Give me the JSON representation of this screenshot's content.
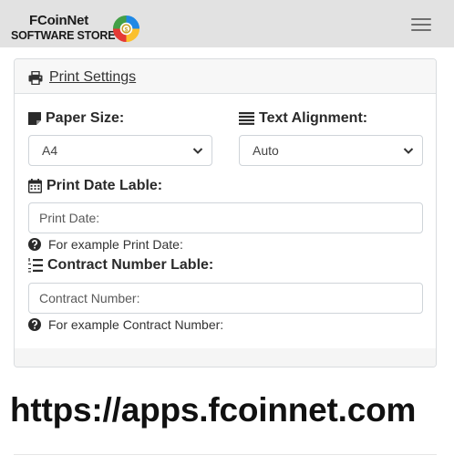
{
  "brand": {
    "name": "FCoinNet",
    "tagline": "SOFTWARE STORE",
    "logo_icon": "fcoinnet-logo-icon"
  },
  "navbar": {
    "toggle_icon": "hamburger-menu-icon"
  },
  "print_settings": {
    "title": "Print Settings",
    "title_icon": "printer-icon",
    "paper_size": {
      "label": "Paper Size:",
      "icon": "sticky-note-icon",
      "selected": "A4"
    },
    "text_alignment": {
      "label": "Text Alignment:",
      "icon": "align-justify-icon",
      "selected": "Auto"
    },
    "print_date_label": {
      "label": "Print Date Lable:",
      "icon": "calendar-icon",
      "value": "Print Date:",
      "hint": "For example Print Date:",
      "hint_icon": "question-circle-icon"
    },
    "contract_number_label": {
      "label": "Contract Number Lable:",
      "icon": "list-ol-icon",
      "value": "Contract Number:",
      "hint": "For example Contract Number:",
      "hint_icon": "question-circle-icon"
    }
  },
  "watermark_url": "https://apps.fcoinnet.com",
  "colors": {
    "navbar_bg": "#e2e2e2",
    "card_header_bg": "#f7f7f7",
    "logo_red": "#e53935",
    "logo_green": "#43a047",
    "logo_blue": "#1e88e5",
    "logo_yellow": "#fbc02d"
  }
}
